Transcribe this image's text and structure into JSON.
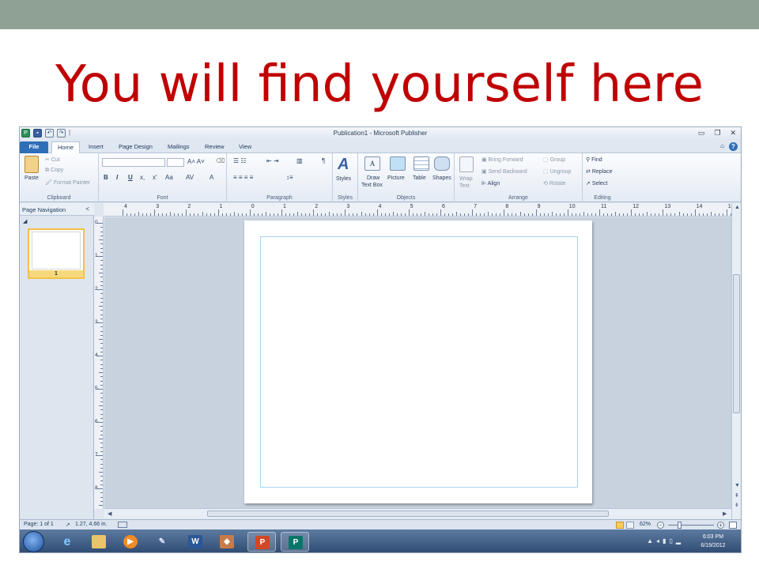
{
  "slide": {
    "heading": "You will find yourself here"
  },
  "window": {
    "title": "Publication1  -  Microsoft Publisher",
    "qat_separator": "|"
  },
  "tabs": {
    "file": "File",
    "items": [
      "Home",
      "Insert",
      "Page Design",
      "Mailings",
      "Review",
      "View"
    ],
    "active": "Home"
  },
  "ribbon": {
    "clipboard": {
      "label": "Clipboard",
      "paste": "Paste",
      "cut": "Cut",
      "copy": "Copy",
      "format_painter": "Format Painter"
    },
    "font": {
      "label": "Font",
      "bold": "B",
      "italic": "I",
      "underline": "U",
      "subscript": "x,",
      "superscript": "x'",
      "case": "Aa",
      "spacing": "AV",
      "color": "A"
    },
    "paragraph": {
      "label": "Paragraph",
      "pilcrow": "¶"
    },
    "styles": {
      "label": "Styles",
      "button": "Styles"
    },
    "objects": {
      "label": "Objects",
      "draw_text_box_1": "Draw",
      "draw_text_box_2": "Text Box",
      "picture": "Picture",
      "table": "Table",
      "shapes": "Shapes"
    },
    "arrange": {
      "label": "Arrange",
      "wrap_1": "Wrap",
      "wrap_2": "Text",
      "bring_forward": "Bring Forward",
      "send_backward": "Send Backward",
      "align": "Align",
      "group": "Group",
      "ungroup": "Ungroup",
      "rotate": "Rotate"
    },
    "editing": {
      "label": "Editing",
      "find": "Find",
      "replace": "Replace",
      "select": "Select"
    }
  },
  "nav_pane": {
    "title": "Page Navigation",
    "collapse": "<",
    "page_number": "1"
  },
  "rulers": {
    "horizontal_ticks": [
      "4",
      "3",
      "2",
      "1",
      "0",
      "1",
      "2",
      "3",
      "4",
      "5",
      "6",
      "7",
      "8",
      "9",
      "10",
      "11",
      "12",
      "13",
      "14",
      "15"
    ],
    "vertical_ticks": [
      "0",
      "1",
      "2",
      "3",
      "4",
      "5",
      "6",
      "7",
      "8"
    ]
  },
  "status": {
    "page": "Page: 1 of 1",
    "position": "1.27, 4.66 in.",
    "zoom": "62%"
  },
  "taskbar": {
    "time": "6:03 PM",
    "date": "6/19/2012"
  },
  "colors": {
    "heading": "#c00000",
    "topbar": "#8fa195",
    "file_tab": "#2e6fb8",
    "margin_guide": "#a5d4ee"
  }
}
